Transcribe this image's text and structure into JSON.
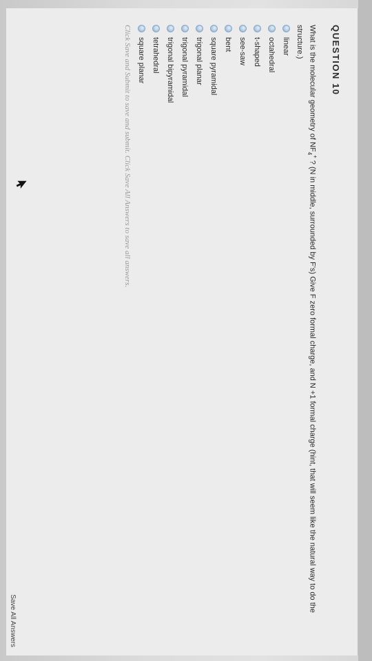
{
  "question": {
    "heading": "QUESTION 10",
    "text_before": "What is the molecular geometry  of NF",
    "subscript": "4",
    "superscript": "+",
    "text_after": " ?  (N in middle, surrounded by F's) Give F zero formal charge, and N +1 formal charge (hint, that will seem like the natural way to do the structure.)"
  },
  "options": [
    "linear",
    "octahedral",
    "t-shaped",
    "see-saw",
    "bent",
    "square pyramidal",
    "trigonal planar",
    "trigonal pyramidal",
    "trigonal bipyramidal",
    "tetrahedral",
    "square planar"
  ],
  "footer": {
    "note": "Click Save and Submit to save and submit. Click Save All Answers to save all answers.",
    "save_all_label": "Save All Answers"
  },
  "icons": {
    "radio": "radio-button-icon",
    "cursor": "mouse-pointer-icon"
  },
  "colors": {
    "radio_accent": "#9fbedb",
    "background": "#ececec",
    "text": "#2a2a2a"
  }
}
